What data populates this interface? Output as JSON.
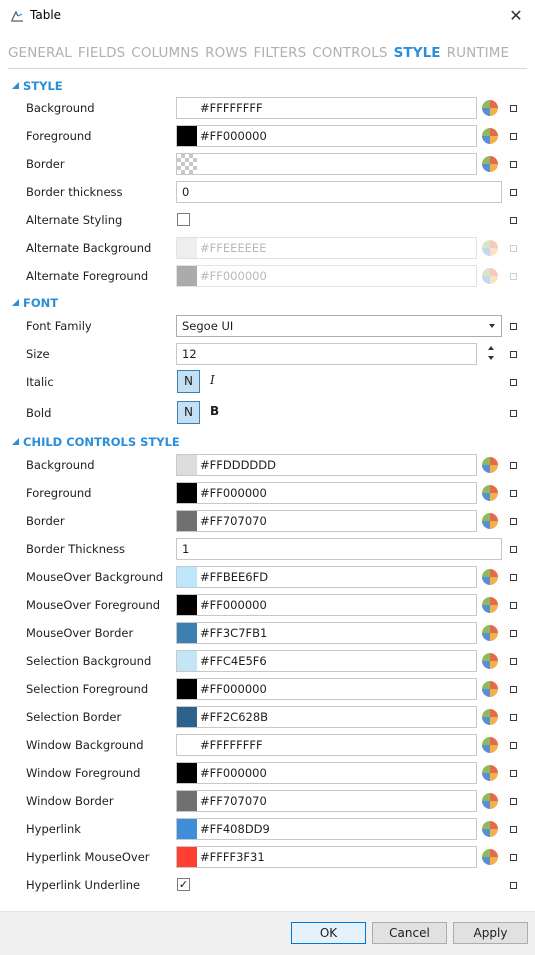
{
  "window": {
    "title": "Table",
    "close_glyph": "✕"
  },
  "tabs": [
    {
      "label": "GENERAL",
      "active": false
    },
    {
      "label": "FIELDS",
      "active": false
    },
    {
      "label": "COLUMNS",
      "active": false
    },
    {
      "label": "ROWS",
      "active": false
    },
    {
      "label": "FILTERS",
      "active": false
    },
    {
      "label": "CONTROLS",
      "active": false
    },
    {
      "label": "STYLE",
      "active": true
    },
    {
      "label": "RUNTIME",
      "active": false
    }
  ],
  "style": {
    "header": "STYLE",
    "background": {
      "label": "Background",
      "value": "#FFFFFFFF",
      "color": "#FFFFFF"
    },
    "foreground": {
      "label": "Foreground",
      "value": "#FF000000",
      "color": "#000000"
    },
    "border": {
      "label": "Border",
      "value": "",
      "color": "transparent"
    },
    "border_thickness": {
      "label": "Border thickness",
      "value": "0"
    },
    "alternate_styling": {
      "label": "Alternate Styling",
      "checked": ""
    },
    "alternate_background": {
      "label": "Alternate Background",
      "value": "#FFEEEEEE",
      "color": "#EEEEEE"
    },
    "alternate_foreground": {
      "label": "Alternate Foreground",
      "value": "#FF000000",
      "color": "#ABABAB"
    }
  },
  "font": {
    "header": "FONT",
    "family": {
      "label": "Font Family",
      "value": "Segoe UI"
    },
    "size": {
      "label": "Size",
      "value": "12"
    },
    "italic": {
      "label": "Italic",
      "normal": "N",
      "alt": "I"
    },
    "bold": {
      "label": "Bold",
      "normal": "N",
      "alt": "B"
    }
  },
  "child": {
    "header": "CHILD CONTROLS STYLE",
    "background": {
      "label": "Background",
      "value": "#FFDDDDDD",
      "color": "#DDDDDD"
    },
    "foreground": {
      "label": "Foreground",
      "value": "#FF000000",
      "color": "#000000"
    },
    "border": {
      "label": "Border",
      "value": "#FF707070",
      "color": "#707070"
    },
    "border_thickness": {
      "label": "Border Thickness",
      "value": "1"
    },
    "mouseover_background": {
      "label": "MouseOver Background",
      "value": "#FFBEE6FD",
      "color": "#BEE6FD"
    },
    "mouseover_foreground": {
      "label": "MouseOver Foreground",
      "value": "#FF000000",
      "color": "#000000"
    },
    "mouseover_border": {
      "label": "MouseOver Border",
      "value": "#FF3C7FB1",
      "color": "#3C7FB1"
    },
    "selection_background": {
      "label": "Selection Background",
      "value": "#FFC4E5F6",
      "color": "#C4E5F6"
    },
    "selection_foreground": {
      "label": "Selection Foreground",
      "value": "#FF000000",
      "color": "#000000"
    },
    "selection_border": {
      "label": "Selection Border",
      "value": "#FF2C628B",
      "color": "#2C628B"
    },
    "window_background": {
      "label": "Window Background",
      "value": "#FFFFFFFF",
      "color": "#FFFFFF"
    },
    "window_foreground": {
      "label": "Window Foreground",
      "value": "#FF000000",
      "color": "#000000"
    },
    "window_border": {
      "label": "Window Border",
      "value": "#FF707070",
      "color": "#707070"
    },
    "hyperlink": {
      "label": "Hyperlink",
      "value": "#FF408DD9",
      "color": "#408DD9"
    },
    "hyperlink_mouseover": {
      "label": "Hyperlink MouseOver",
      "value": "#FFFF3F31",
      "color": "#FF3F31"
    },
    "hyperlink_underline": {
      "label": "Hyperlink Underline",
      "checked": "✓"
    }
  },
  "buttons": {
    "ok": "OK",
    "cancel": "Cancel",
    "apply": "Apply"
  }
}
